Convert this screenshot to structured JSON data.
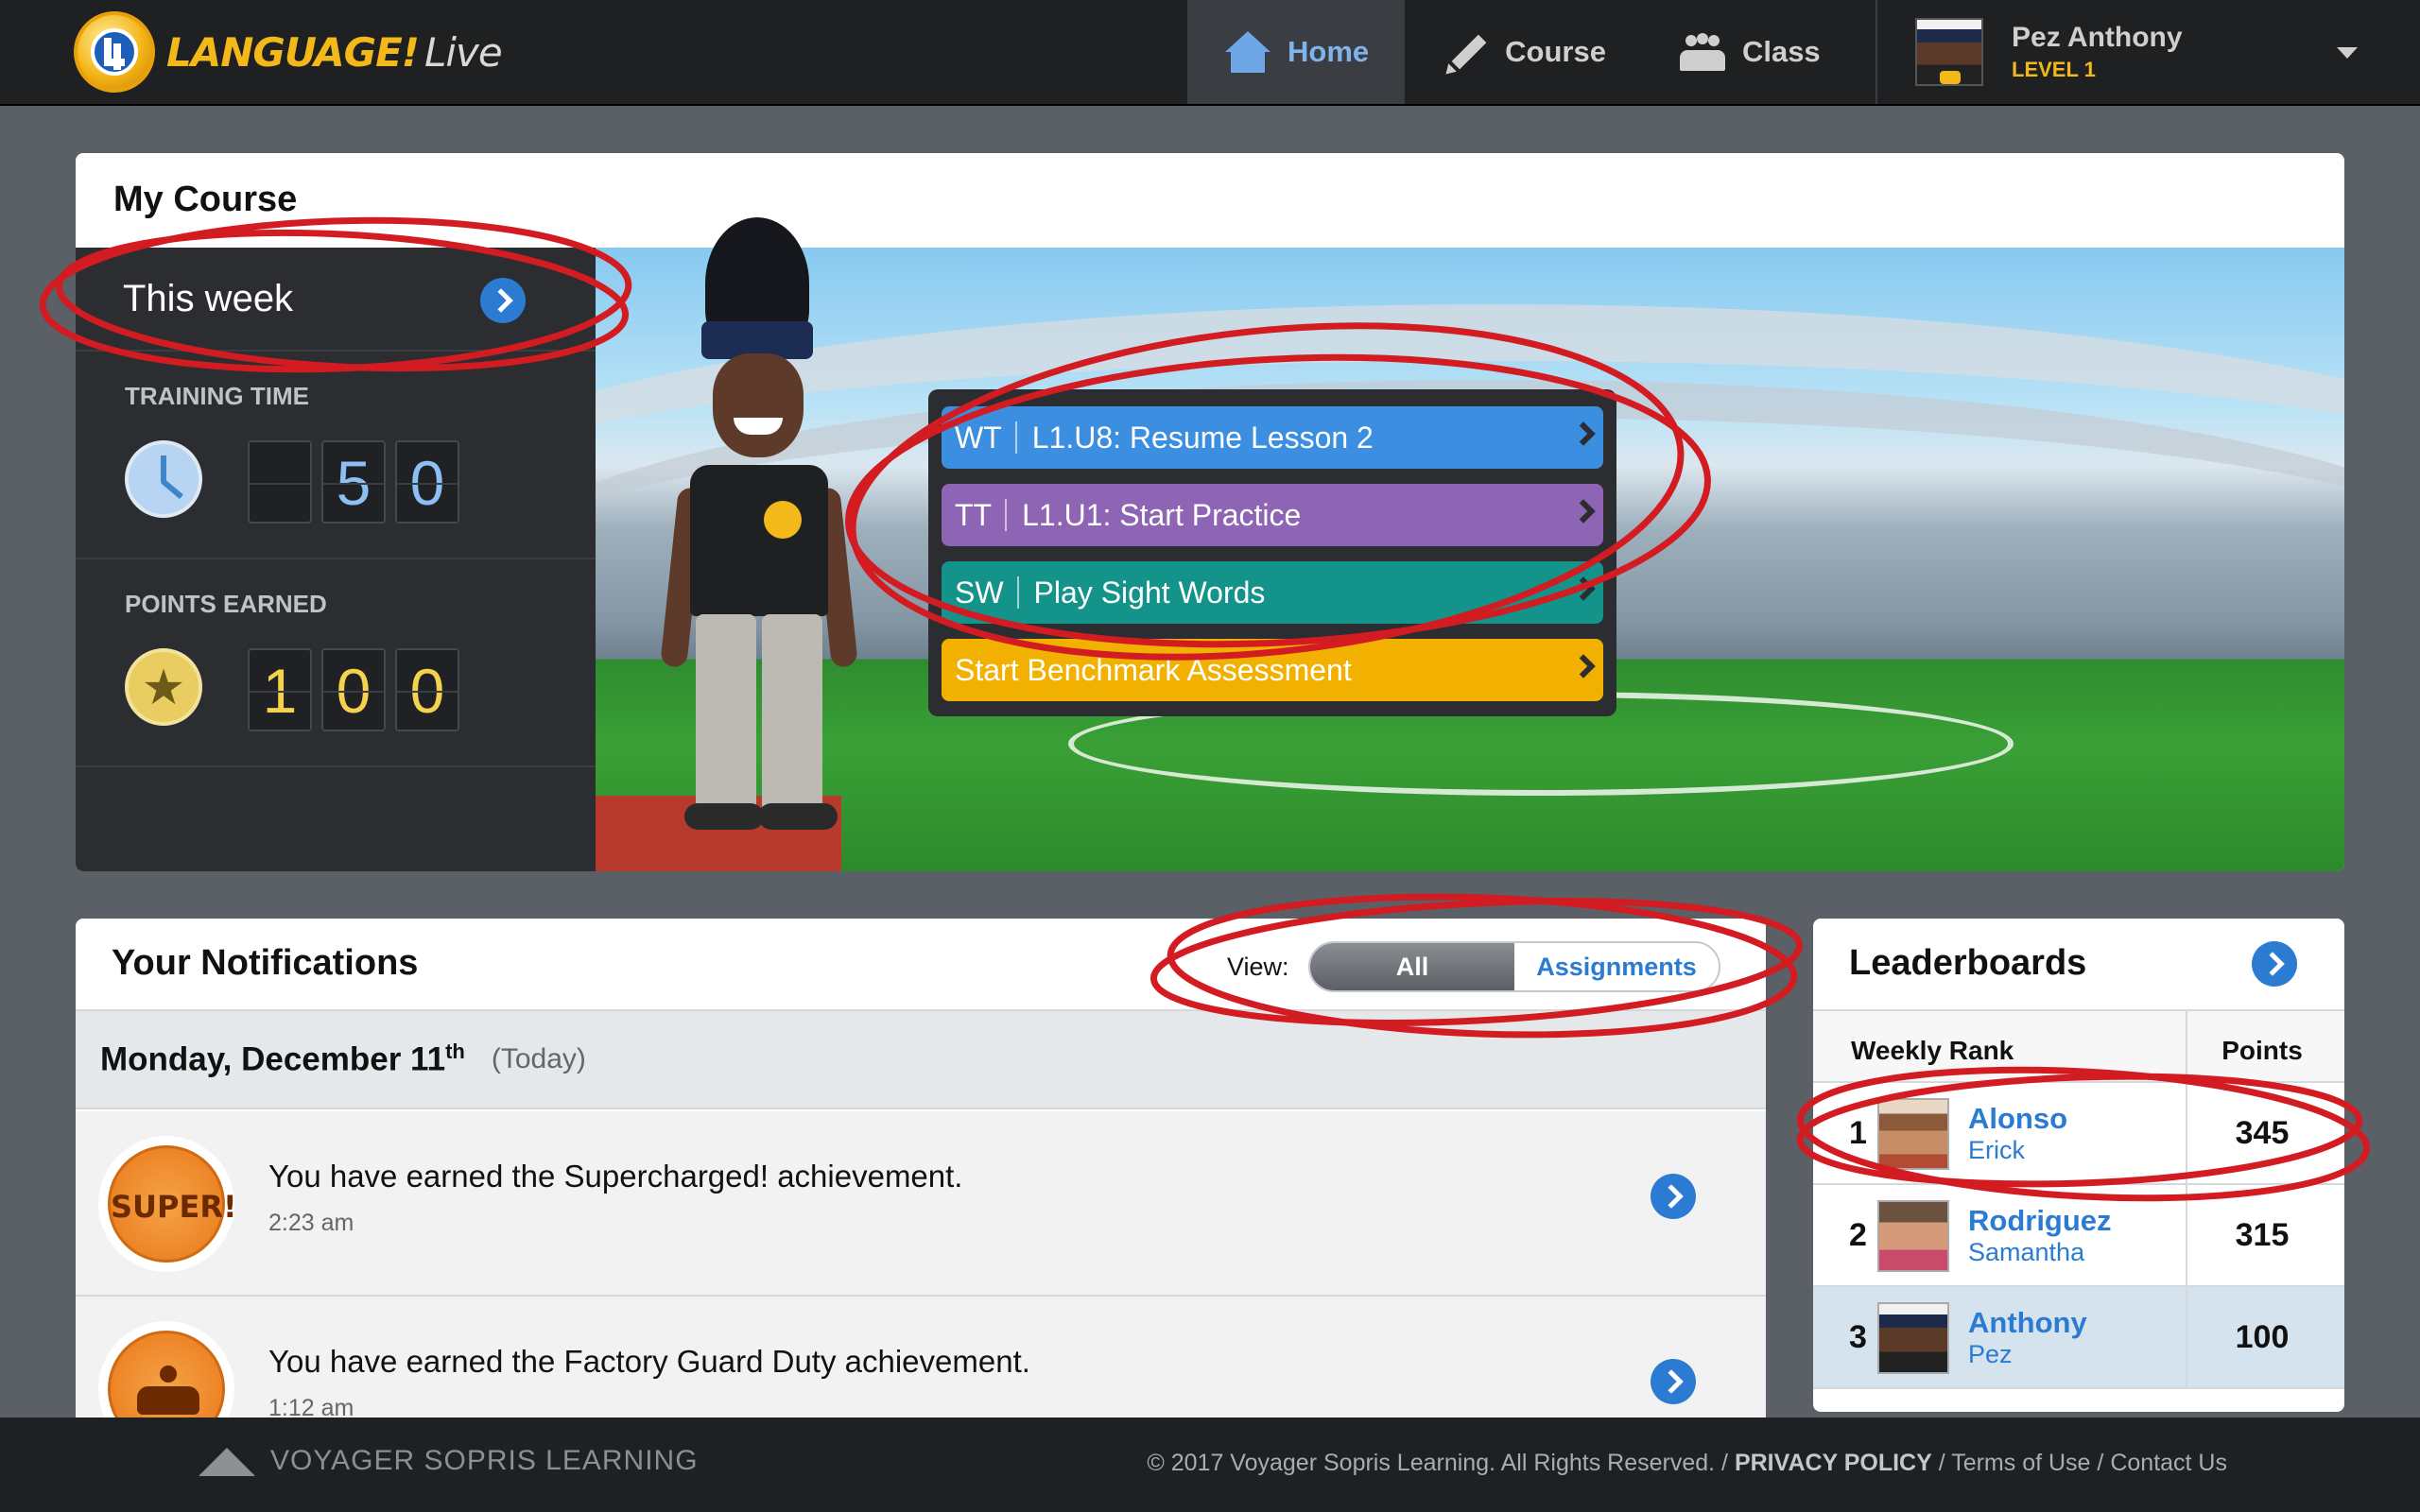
{
  "header": {
    "logo_main": "LANGUAGE!",
    "logo_sub": "Live",
    "nav": [
      {
        "label": "Home",
        "icon": "home-icon",
        "active": true
      },
      {
        "label": "Course",
        "icon": "pencil-icon",
        "active": false
      },
      {
        "label": "Class",
        "icon": "class-icon",
        "active": false
      }
    ],
    "user": {
      "name": "Pez Anthony",
      "level": "LEVEL 1",
      "icon": "chevron-down-icon"
    }
  },
  "my_course": {
    "title": "My Course",
    "this_week": "This week",
    "training_time": {
      "label": "TRAINING TIME",
      "digits": [
        "",
        "5",
        "0"
      ]
    },
    "points_earned": {
      "label": "POINTS EARNED",
      "digits": [
        "1",
        "0",
        "0"
      ]
    },
    "tasks": [
      {
        "code": "WT",
        "label": "L1.U8: Resume Lesson 2",
        "color": "#3c8ee0"
      },
      {
        "code": "TT",
        "label": "L1.U1: Start Practice",
        "color": "#8e64b4"
      },
      {
        "code": "SW",
        "label": "Play Sight Words",
        "color": "#14938a"
      },
      {
        "code": "",
        "label": "Start Benchmark Assessment",
        "color": "#f2b100"
      }
    ]
  },
  "notifications": {
    "title": "Your Notifications",
    "view_label": "View:",
    "toggle_all": "All",
    "toggle_assignments": "Assignments",
    "day": {
      "date": "Monday, December 11",
      "suffix": "th",
      "tag": "(Today)"
    },
    "items": [
      {
        "badge": "SUPER!",
        "text": "You have earned the Supercharged! achievement.",
        "time": "2:23 am"
      },
      {
        "badge": "",
        "text": "You have earned the Factory Guard Duty achievement.",
        "time": "1:12 am"
      }
    ]
  },
  "leaderboards": {
    "title": "Leaderboards",
    "col_rank": "Weekly Rank",
    "col_points": "Points",
    "rows": [
      {
        "rank": "1",
        "last": "Alonso",
        "first": "Erick",
        "points": "345"
      },
      {
        "rank": "2",
        "last": "Rodriguez",
        "first": "Samantha",
        "points": "315"
      },
      {
        "rank": "3",
        "last": "Anthony",
        "first": "Pez",
        "points": "100"
      }
    ]
  },
  "footer": {
    "brand": "VOYAGER SOPRIS LEARNING",
    "copyright": "© 2017 Voyager Sopris Learning. All Rights Reserved.",
    "privacy": "PRIVACY POLICY",
    "terms": "Terms of Use",
    "contact": "Contact Us",
    "separator": "/"
  },
  "colors": {
    "annotation": "#d31b22",
    "accent_blue": "#2b7bd2",
    "brand_gold": "#f3b81a"
  }
}
